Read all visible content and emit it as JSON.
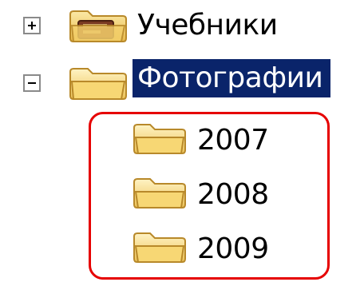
{
  "tree": {
    "nodes": [
      {
        "label": "Учебники",
        "expander": "plus",
        "icon": "folder-with-book-icon",
        "selected": false
      },
      {
        "label": "Фотографии",
        "expander": "minus",
        "icon": "folder-open-icon",
        "selected": true,
        "children": [
          {
            "label": "2007",
            "icon": "folder-icon"
          },
          {
            "label": "2008",
            "icon": "folder-icon"
          },
          {
            "label": "2009",
            "icon": "folder-icon"
          }
        ]
      }
    ]
  },
  "colors": {
    "selection_bg": "#0a246a",
    "selection_text": "#ffffff",
    "highlight_border": "#e60000",
    "folder_fill": "#f7d774"
  }
}
